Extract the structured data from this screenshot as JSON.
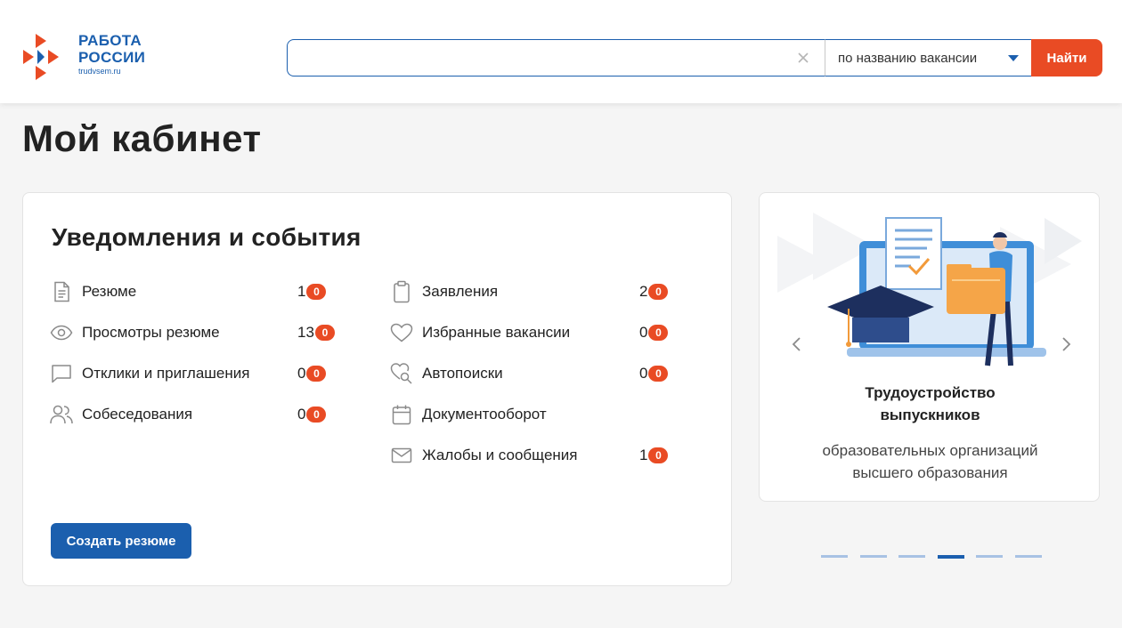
{
  "header": {
    "logo": {
      "line1": "РАБОТА",
      "line2": "РОССИИ",
      "domain": "trudvsem.ru",
      "brand_color": "#1b5fae",
      "accent_color": "#e94b24"
    },
    "search": {
      "value": "",
      "placeholder": "",
      "type_selected": "по названию вакансии",
      "submit_label": "Найти"
    }
  },
  "page": {
    "title": "Мой кабинет"
  },
  "notifications": {
    "title": "Уведомления и события",
    "left": [
      {
        "icon": "document-icon",
        "label": "Резюме",
        "count": "1",
        "badge": "0"
      },
      {
        "icon": "eye-icon",
        "label": "Просмотры резюме",
        "count": "13",
        "badge": "0"
      },
      {
        "icon": "chat-icon",
        "label": "Отклики и приглашения",
        "count": "0",
        "badge": "0"
      },
      {
        "icon": "users-icon",
        "label": "Собеседования",
        "count": "0",
        "badge": "0"
      }
    ],
    "right": [
      {
        "icon": "clipboard-icon",
        "label": "Заявления",
        "count": "2",
        "badge": "0"
      },
      {
        "icon": "heart-icon",
        "label": "Избранные вакансии",
        "count": "0",
        "badge": "0"
      },
      {
        "icon": "heart-search-icon",
        "label": "Автопоиски",
        "count": "0",
        "badge": "0"
      },
      {
        "icon": "calendar-icon",
        "label": "Документооборот",
        "count": "",
        "badge": ""
      },
      {
        "icon": "envelope-icon",
        "label": "Жалобы и сообщения",
        "count": "1",
        "badge": "0"
      }
    ],
    "create_button": "Создать резюме"
  },
  "promo": {
    "title": "Трудоустройство выпускников",
    "subtitle": "образовательных организаций высшего образования",
    "slides_total": 6,
    "active_slide": 4
  }
}
